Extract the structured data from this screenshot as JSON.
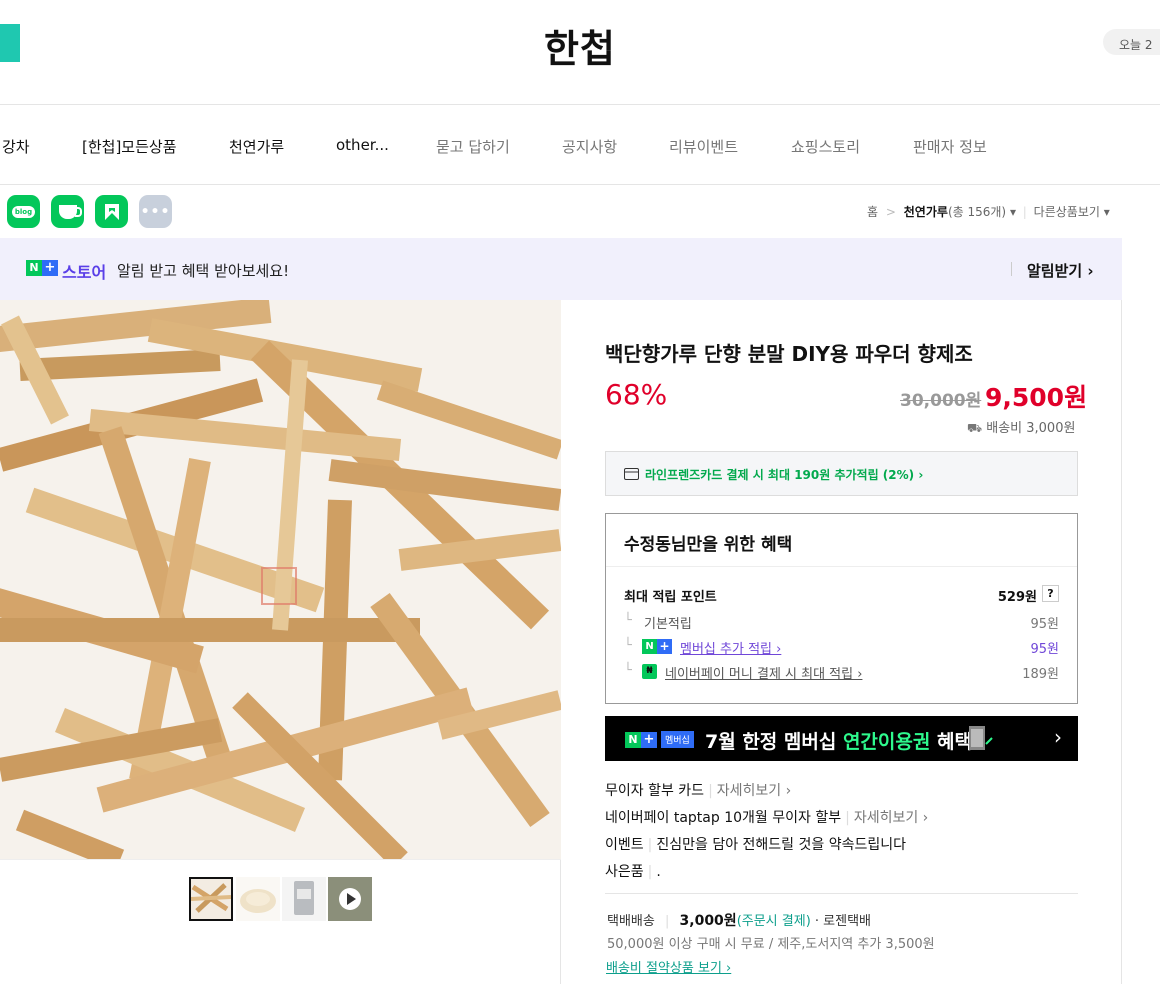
{
  "header": {
    "title": "한첩",
    "today_label": "오늘 2"
  },
  "nav": {
    "items": [
      "강차",
      "[한첩]모든상품",
      "천연가루",
      "other...",
      "묻고 답하기",
      "공지사항",
      "리뷰이벤트",
      "쇼핑스토리",
      "판매자 정보"
    ]
  },
  "social": {
    "blog_label": "blog"
  },
  "breadcrumb": {
    "home": "홈",
    "sep": ">",
    "category": "천연가루",
    "count": "(총 156개)",
    "other": "다른상품보기"
  },
  "promo": {
    "n": "N",
    "plus": "+",
    "store": "스토어",
    "text": "알림 받고 혜택 받아보세요!",
    "link": "알림받기 ›"
  },
  "product": {
    "title": "백단향가루 단향 분말 DIY용 파우더 향제조",
    "discount": "68%",
    "original_price": "30,000원",
    "sale_price": "9,500원",
    "shipping_fee": "배송비 3,000원"
  },
  "card_offer": {
    "text": "라인프렌즈카드 결제 시 최대 190원 추가적립 (2%) ›"
  },
  "benefit": {
    "title": "수정동님만을 위한 혜택",
    "max_label": "최대 적립 포인트",
    "max_value": "529원",
    "help": "?",
    "rows": [
      {
        "label": "기본적립",
        "value": "95원"
      },
      {
        "label": "멤버십 추가 적립 ›",
        "value": "95원"
      },
      {
        "label": "네이버페이 머니 결제 시 최대 적립 ›",
        "value": "189원"
      }
    ]
  },
  "membership_banner": {
    "badge": "멤버십",
    "text_a": "7월 한정 멤버십 ",
    "text_b": "연간이용권",
    "text_c": " 혜택",
    "arrow": "›"
  },
  "extra": {
    "installment_label": "무이자 할부 카드",
    "installment_link": "자세히보기 ›",
    "taptap_label": "네이버페이 taptap 10개월 무이자 할부",
    "taptap_link": "자세히보기 ›",
    "event_label": "이벤트",
    "event_text": "진심만을 담아 전해드릴 것을 약속드립니다",
    "gift_label": "사은품",
    "gift_text": "."
  },
  "shipping": {
    "method": "택배배송",
    "fee": "3,000원",
    "pay": "(주문시 결제)",
    "carrier": "· 로젠택배",
    "note": "50,000원 이상 구매 시 무료 / 제주,도서지역 추가 3,500원",
    "link": "배송비 절약상품 보기 ›"
  },
  "colors": {
    "accent_red": "#e0002a",
    "naver_green": "#03c75a",
    "teal": "#1fc8b0"
  }
}
